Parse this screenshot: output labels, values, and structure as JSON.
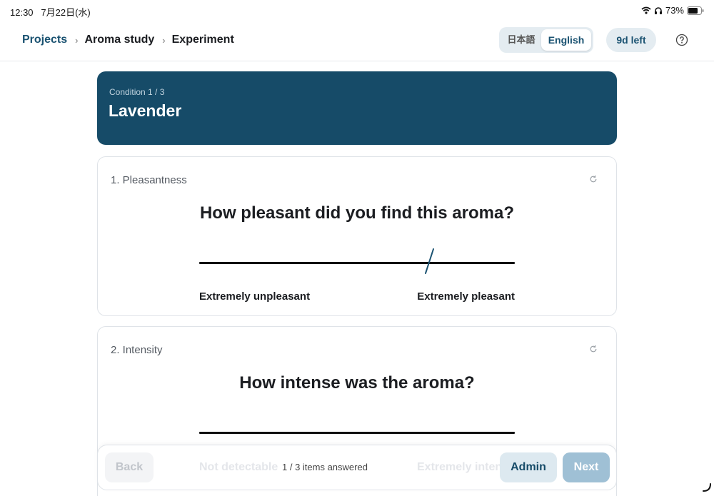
{
  "status_bar": {
    "time": "12:30",
    "date": "7月22日(水)",
    "battery": "73%"
  },
  "breadcrumb": {
    "projects": "Projects",
    "study": "Aroma study",
    "page": "Experiment",
    "separator": "›"
  },
  "language": {
    "ja": "日本語",
    "en": "English",
    "selected": "English"
  },
  "deadline": "9d left",
  "condition": {
    "counter": "Condition 1 / 3",
    "name": "Lavender"
  },
  "questions": [
    {
      "label": "1. Pleasantness",
      "text": "How pleasant did you find this aroma?",
      "anchor_left": "Extremely unpleasant",
      "anchor_right": "Extremely pleasant",
      "response_fraction": 0.73
    },
    {
      "label": "2. Intensity",
      "text": "How intense was the aroma?",
      "anchor_left": "Not detectable",
      "anchor_right": "Extremely intense"
    }
  ],
  "bottom": {
    "back": "Back",
    "progress": "1 / 3 items answered",
    "admin": "Admin",
    "next": "Next",
    "faded_left": "Not detectable",
    "faded_right": "Extremely inten"
  },
  "colors": {
    "accent": "#164b68",
    "link": "#1a5271",
    "pill_bg": "#e4ecf1",
    "next_disabled": "#9fc0d5"
  },
  "icons": {
    "help": "help-circle-icon",
    "reset": "refresh-icon",
    "wifi": "wifi-icon",
    "headphones": "headphones-icon",
    "battery": "battery-icon"
  }
}
